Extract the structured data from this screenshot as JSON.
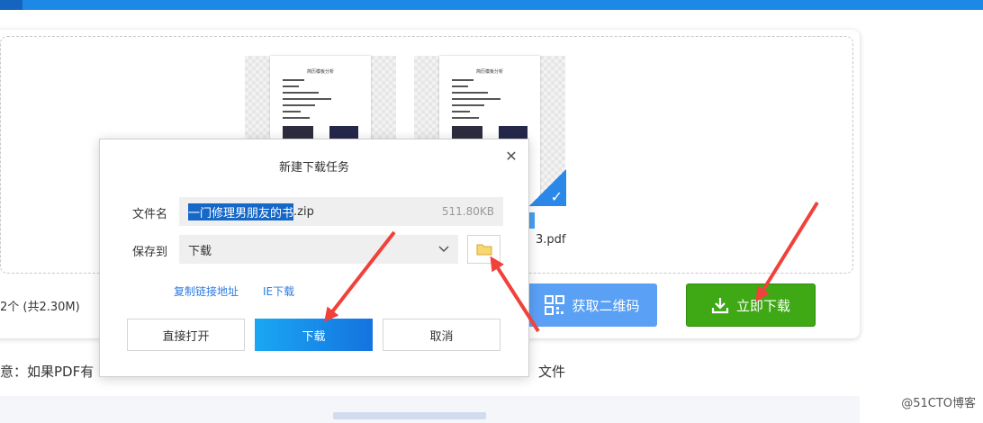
{
  "page": {
    "files_summary": "2个  (共2.30M)",
    "second_file_name_partial": "3.pdf",
    "qr_button_label": "获取二维码",
    "download_now_label": "立即下载",
    "note_prefix": "意：如果PDF有",
    "note_suffix": "文件",
    "watermark": "@51CTO博客"
  },
  "thumbnail": {
    "doc_title": "简历模板分析"
  },
  "dialog": {
    "title": "新建下载任务",
    "filename_label": "文件名",
    "filename_selected": "一门修理男朋友的书",
    "filename_ext": ".zip",
    "file_size": "511.80KB",
    "save_to_label": "保存到",
    "save_to_value": "下载",
    "copy_link_label": "复制链接地址",
    "ie_download_label": "IE下载",
    "open_label": "直接打开",
    "download_label": "下载",
    "cancel_label": "取消"
  },
  "icons": {
    "close": "close-icon",
    "folder": "folder-icon",
    "chevron": "chevron-down-icon",
    "qr": "qr-code-icon",
    "download": "download-icon",
    "check": "check-icon"
  },
  "colors": {
    "topbar": "#1e88e5",
    "download_now": "#3ea815",
    "qr_button": "#5aa0f5",
    "arrow": "#f0413a",
    "link": "#2a7ae2"
  }
}
